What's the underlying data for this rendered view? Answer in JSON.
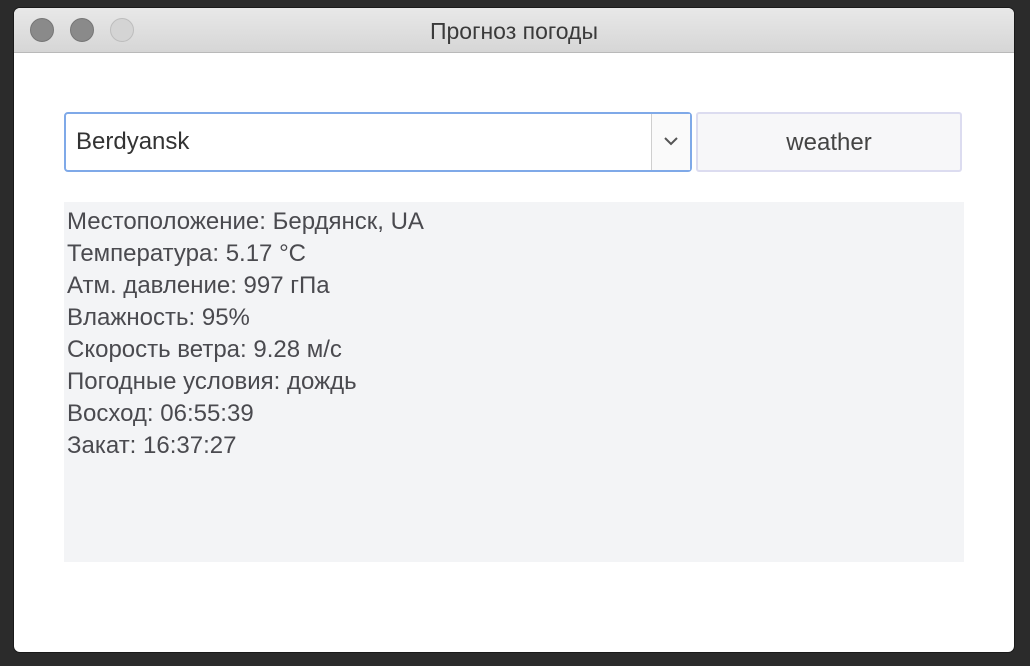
{
  "window": {
    "title": "Прогноз погоды"
  },
  "city_combo": {
    "value": "Berdyansk"
  },
  "weather_button": {
    "label": "weather"
  },
  "output": {
    "lines": [
      "Местоположение: Бердянск, UA",
      "Температура: 5.17 °C",
      "Атм. давление: 997 гПа",
      "Влажность: 95%",
      "Скорость ветра: 9.28 м/с",
      "Погодные условия: дождь",
      "Восход: 06:55:39",
      "Закат: 16:37:27"
    ]
  },
  "colors": {
    "focus_border": "#7fa9e8",
    "output_background": "#f3f4f6"
  }
}
